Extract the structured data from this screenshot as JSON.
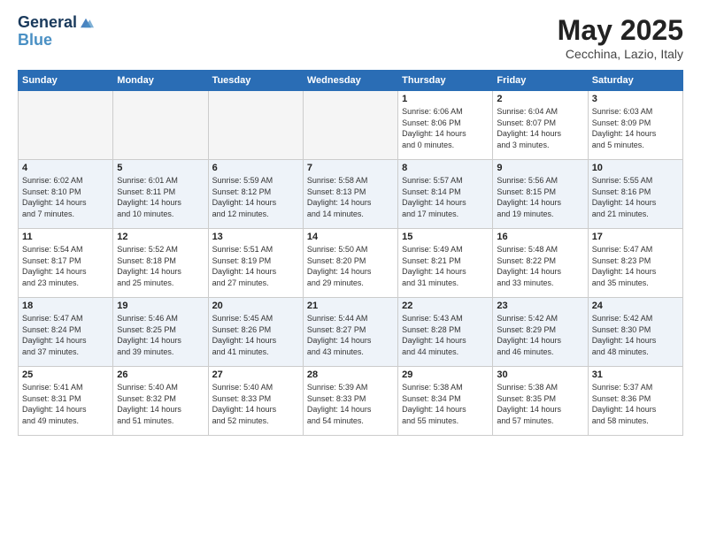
{
  "header": {
    "logo_line1": "General",
    "logo_line2": "Blue",
    "month": "May 2025",
    "location": "Cecchina, Lazio, Italy"
  },
  "days_of_week": [
    "Sunday",
    "Monday",
    "Tuesday",
    "Wednesday",
    "Thursday",
    "Friday",
    "Saturday"
  ],
  "weeks": [
    [
      {
        "day": "",
        "detail": "",
        "empty": true
      },
      {
        "day": "",
        "detail": "",
        "empty": true
      },
      {
        "day": "",
        "detail": "",
        "empty": true
      },
      {
        "day": "",
        "detail": "",
        "empty": true
      },
      {
        "day": "1",
        "detail": "Sunrise: 6:06 AM\nSunset: 8:06 PM\nDaylight: 14 hours\nand 0 minutes.",
        "empty": false
      },
      {
        "day": "2",
        "detail": "Sunrise: 6:04 AM\nSunset: 8:07 PM\nDaylight: 14 hours\nand 3 minutes.",
        "empty": false
      },
      {
        "day": "3",
        "detail": "Sunrise: 6:03 AM\nSunset: 8:09 PM\nDaylight: 14 hours\nand 5 minutes.",
        "empty": false
      }
    ],
    [
      {
        "day": "4",
        "detail": "Sunrise: 6:02 AM\nSunset: 8:10 PM\nDaylight: 14 hours\nand 7 minutes.",
        "empty": false
      },
      {
        "day": "5",
        "detail": "Sunrise: 6:01 AM\nSunset: 8:11 PM\nDaylight: 14 hours\nand 10 minutes.",
        "empty": false
      },
      {
        "day": "6",
        "detail": "Sunrise: 5:59 AM\nSunset: 8:12 PM\nDaylight: 14 hours\nand 12 minutes.",
        "empty": false
      },
      {
        "day": "7",
        "detail": "Sunrise: 5:58 AM\nSunset: 8:13 PM\nDaylight: 14 hours\nand 14 minutes.",
        "empty": false
      },
      {
        "day": "8",
        "detail": "Sunrise: 5:57 AM\nSunset: 8:14 PM\nDaylight: 14 hours\nand 17 minutes.",
        "empty": false
      },
      {
        "day": "9",
        "detail": "Sunrise: 5:56 AM\nSunset: 8:15 PM\nDaylight: 14 hours\nand 19 minutes.",
        "empty": false
      },
      {
        "day": "10",
        "detail": "Sunrise: 5:55 AM\nSunset: 8:16 PM\nDaylight: 14 hours\nand 21 minutes.",
        "empty": false
      }
    ],
    [
      {
        "day": "11",
        "detail": "Sunrise: 5:54 AM\nSunset: 8:17 PM\nDaylight: 14 hours\nand 23 minutes.",
        "empty": false
      },
      {
        "day": "12",
        "detail": "Sunrise: 5:52 AM\nSunset: 8:18 PM\nDaylight: 14 hours\nand 25 minutes.",
        "empty": false
      },
      {
        "day": "13",
        "detail": "Sunrise: 5:51 AM\nSunset: 8:19 PM\nDaylight: 14 hours\nand 27 minutes.",
        "empty": false
      },
      {
        "day": "14",
        "detail": "Sunrise: 5:50 AM\nSunset: 8:20 PM\nDaylight: 14 hours\nand 29 minutes.",
        "empty": false
      },
      {
        "day": "15",
        "detail": "Sunrise: 5:49 AM\nSunset: 8:21 PM\nDaylight: 14 hours\nand 31 minutes.",
        "empty": false
      },
      {
        "day": "16",
        "detail": "Sunrise: 5:48 AM\nSunset: 8:22 PM\nDaylight: 14 hours\nand 33 minutes.",
        "empty": false
      },
      {
        "day": "17",
        "detail": "Sunrise: 5:47 AM\nSunset: 8:23 PM\nDaylight: 14 hours\nand 35 minutes.",
        "empty": false
      }
    ],
    [
      {
        "day": "18",
        "detail": "Sunrise: 5:47 AM\nSunset: 8:24 PM\nDaylight: 14 hours\nand 37 minutes.",
        "empty": false
      },
      {
        "day": "19",
        "detail": "Sunrise: 5:46 AM\nSunset: 8:25 PM\nDaylight: 14 hours\nand 39 minutes.",
        "empty": false
      },
      {
        "day": "20",
        "detail": "Sunrise: 5:45 AM\nSunset: 8:26 PM\nDaylight: 14 hours\nand 41 minutes.",
        "empty": false
      },
      {
        "day": "21",
        "detail": "Sunrise: 5:44 AM\nSunset: 8:27 PM\nDaylight: 14 hours\nand 43 minutes.",
        "empty": false
      },
      {
        "day": "22",
        "detail": "Sunrise: 5:43 AM\nSunset: 8:28 PM\nDaylight: 14 hours\nand 44 minutes.",
        "empty": false
      },
      {
        "day": "23",
        "detail": "Sunrise: 5:42 AM\nSunset: 8:29 PM\nDaylight: 14 hours\nand 46 minutes.",
        "empty": false
      },
      {
        "day": "24",
        "detail": "Sunrise: 5:42 AM\nSunset: 8:30 PM\nDaylight: 14 hours\nand 48 minutes.",
        "empty": false
      }
    ],
    [
      {
        "day": "25",
        "detail": "Sunrise: 5:41 AM\nSunset: 8:31 PM\nDaylight: 14 hours\nand 49 minutes.",
        "empty": false
      },
      {
        "day": "26",
        "detail": "Sunrise: 5:40 AM\nSunset: 8:32 PM\nDaylight: 14 hours\nand 51 minutes.",
        "empty": false
      },
      {
        "day": "27",
        "detail": "Sunrise: 5:40 AM\nSunset: 8:33 PM\nDaylight: 14 hours\nand 52 minutes.",
        "empty": false
      },
      {
        "day": "28",
        "detail": "Sunrise: 5:39 AM\nSunset: 8:33 PM\nDaylight: 14 hours\nand 54 minutes.",
        "empty": false
      },
      {
        "day": "29",
        "detail": "Sunrise: 5:38 AM\nSunset: 8:34 PM\nDaylight: 14 hours\nand 55 minutes.",
        "empty": false
      },
      {
        "day": "30",
        "detail": "Sunrise: 5:38 AM\nSunset: 8:35 PM\nDaylight: 14 hours\nand 57 minutes.",
        "empty": false
      },
      {
        "day": "31",
        "detail": "Sunrise: 5:37 AM\nSunset: 8:36 PM\nDaylight: 14 hours\nand 58 minutes.",
        "empty": false
      }
    ]
  ]
}
